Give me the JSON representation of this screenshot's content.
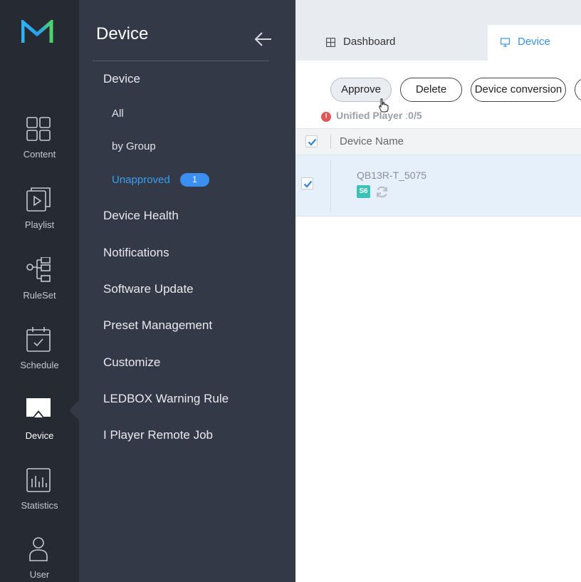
{
  "rail": {
    "items": [
      {
        "label": "Content",
        "icon": "grid-icon"
      },
      {
        "label": "Playlist",
        "icon": "playlist-icon"
      },
      {
        "label": "RuleSet",
        "icon": "ruleset-icon"
      },
      {
        "label": "Schedule",
        "icon": "calendar-icon"
      },
      {
        "label": "Device",
        "icon": "device-icon",
        "active": true
      },
      {
        "label": "Statistics",
        "icon": "bar-chart-icon"
      },
      {
        "label": "User",
        "icon": "user-icon"
      }
    ]
  },
  "submenu": {
    "title": "Device",
    "items": [
      {
        "label": "Device"
      },
      {
        "label": "All"
      },
      {
        "label": "by Group"
      },
      {
        "label": "Unapproved",
        "badge": "1",
        "active": true
      },
      {
        "label": "Device Health"
      },
      {
        "label": "Notifications"
      },
      {
        "label": "Software Update"
      },
      {
        "label": "Preset Management"
      },
      {
        "label": "Customize"
      },
      {
        "label": "LEDBOX Warning Rule"
      },
      {
        "label": "I Player Remote Job"
      }
    ]
  },
  "tabs": [
    {
      "label": "Dashboard"
    },
    {
      "label": "Device",
      "active": true
    }
  ],
  "toolbar": {
    "approve": "Approve",
    "delete": "Delete",
    "conversion": "Device conversion"
  },
  "info": {
    "label": "Unified Player",
    "separator": " :",
    "count": "0/5"
  },
  "table": {
    "columns": [
      "Device Name"
    ],
    "rows": [
      {
        "name": "QB13R-T_5075",
        "badge": "S6",
        "checked": true
      }
    ]
  },
  "colors": {
    "rail_bg": "#262a33",
    "submenu_bg": "#333947",
    "accent": "#3a8fe8",
    "row_selected": "#e6f0fb"
  }
}
